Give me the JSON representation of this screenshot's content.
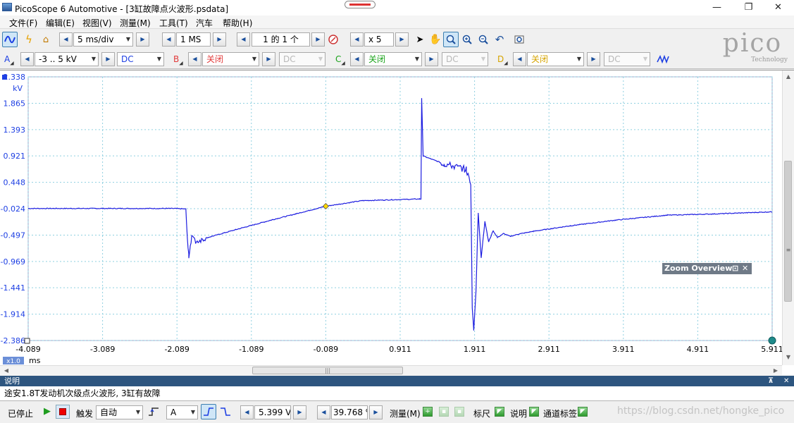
{
  "window": {
    "title": "PicoScope 6 Automotive - [3缸故障点火波形.psdata]",
    "minimize_glyph": "—",
    "restore_glyph": "❐",
    "close_glyph": "✕"
  },
  "menu": [
    "文件(F)",
    "编辑(E)",
    "视图(V)",
    "测量(M)",
    "工具(T)",
    "汽车",
    "帮助(H)"
  ],
  "toolbar": {
    "timebase": "5 ms/div",
    "samples": "1 MS",
    "buffer": "1 的 1 个",
    "zoom": "x 5",
    "icons": [
      "scope-view-icon",
      "lightning-icon",
      "home-icon",
      "buffer-navigator-icon",
      "pointer-icon",
      "hand-icon",
      "zoom-rect-icon",
      "zoom-in-icon",
      "zoom-out-icon",
      "undo-zoom-icon",
      "zoom-overview-icon"
    ]
  },
  "channels": [
    {
      "letter": "A",
      "range": "-3 .. 5 kV",
      "coupling": "DC",
      "color": "#1d3fe3",
      "enabled": true
    },
    {
      "letter": "B",
      "range": "关闭",
      "coupling": "DC",
      "color": "#e23b3b",
      "enabled": false
    },
    {
      "letter": "C",
      "range": "关闭",
      "coupling": "DC",
      "color": "#1aa31a",
      "enabled": false
    },
    {
      "letter": "D",
      "range": "关闭",
      "coupling": "DC",
      "color": "#d6a400",
      "enabled": false
    }
  ],
  "logo": {
    "word": "pico",
    "sub": "Technology"
  },
  "scope": {
    "y_unit": "kV",
    "x_unit": "ms",
    "zoom_badge": "x1.0",
    "y_ticks": [
      "2.338",
      "1.865",
      "1.393",
      "0.921",
      "0.448",
      "-0.024",
      "-0.497",
      "-0.969",
      "-1.441",
      "-1.914",
      "-2.386"
    ],
    "x_ticks": [
      "-4.089",
      "-3.089",
      "-2.089",
      "-1.089",
      "-0.089",
      "0.911",
      "1.911",
      "2.911",
      "3.911",
      "4.911",
      "5.911"
    ],
    "grid": true,
    "trace_color": "#1d1de0",
    "trigger_marker_color": "#ffd800",
    "zoom_overview_label": "Zoom Overview",
    "zoom_overview_pin": "⊡",
    "zoom_overview_close": "✕"
  },
  "notes": {
    "header": "说明",
    "pin_glyph": "⊼",
    "close_glyph": "✕",
    "text": "途安1.8T发动机次级点火波形, 3缸有故障"
  },
  "statusbar": {
    "state": "已停止",
    "trigger_label": "触发",
    "trigger_mode": "自动",
    "trigger_source": "A",
    "threshold": "5.399 V",
    "pretrigger": "39.768 %",
    "measure": "测量(M)",
    "ruler": "标尺",
    "notes": "说明",
    "channel_labels": "通道标签",
    "watermark": "https://blog.csdn.net/hongke_pico"
  },
  "chart_data": {
    "type": "line",
    "title": "",
    "xlabel": "ms",
    "ylabel": "kV",
    "xlim": [
      -4.089,
      5.911
    ],
    "ylim": [
      -2.386,
      2.338
    ],
    "grid": true,
    "series": [
      {
        "name": "A",
        "x": [
          -4.089,
          -2.12,
          -1.97,
          -1.95,
          -1.93,
          -1.89,
          -1.84,
          -1.7,
          -1.3,
          -0.8,
          -0.5,
          -0.089,
          0.4,
          1.17,
          1.19,
          1.2,
          1.22,
          1.5,
          1.8,
          1.86,
          1.88,
          1.9,
          1.93,
          1.96,
          2.0,
          2.05,
          2.1,
          2.16,
          2.22,
          2.3,
          2.39,
          2.5,
          2.7,
          3.2,
          3.8,
          4.5,
          5.1,
          5.911
        ],
        "y": [
          -0.02,
          -0.02,
          -0.03,
          -0.55,
          -0.88,
          -0.5,
          -0.62,
          -0.55,
          -0.4,
          -0.22,
          -0.12,
          0.02,
          0.12,
          0.15,
          0.15,
          1.95,
          0.92,
          0.78,
          0.68,
          0.4,
          -1.8,
          -2.2,
          -1.5,
          -0.1,
          -0.9,
          -0.25,
          -0.62,
          -0.42,
          -0.54,
          -0.47,
          -0.52,
          -0.48,
          -0.43,
          -0.33,
          -0.23,
          -0.14,
          -0.12,
          -0.08
        ]
      }
    ]
  }
}
